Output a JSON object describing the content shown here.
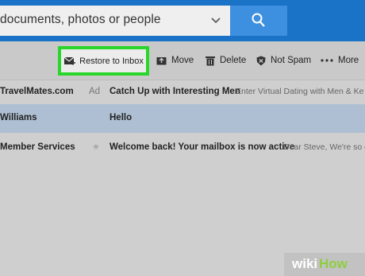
{
  "search": {
    "text": "documents, photos or people"
  },
  "toolbar": {
    "restore_label": "Restore to Inbox",
    "move_label": "Move",
    "delete_label": "Delete",
    "not_spam_label": "Not Spam",
    "more_label": "More"
  },
  "messages": [
    {
      "sender": "TravelMates.com",
      "tag": "Ad",
      "subject": "Catch Up with Interesting Men",
      "preview": "Enter Virtual Dating with Men & Ke"
    },
    {
      "sender": "Williams",
      "subject": "Hello",
      "preview": ""
    },
    {
      "sender": "Member Services",
      "subject": "Welcome back! Your mailbox is now active",
      "preview": "Dear Steve, We're so gl"
    }
  ],
  "watermark": {
    "wiki": "wiki",
    "how": "How"
  },
  "colors": {
    "header_blue": "#1b73c7",
    "search_button": "#3d8fe0",
    "highlight_green": "#29d62b",
    "selected_row": "#aebfd3"
  },
  "icons": [
    "chevron-down-icon",
    "search-icon",
    "restore-mail-icon",
    "move-folder-icon",
    "trash-icon",
    "shield-icon",
    "more-dots-icon",
    "star-icon"
  ]
}
